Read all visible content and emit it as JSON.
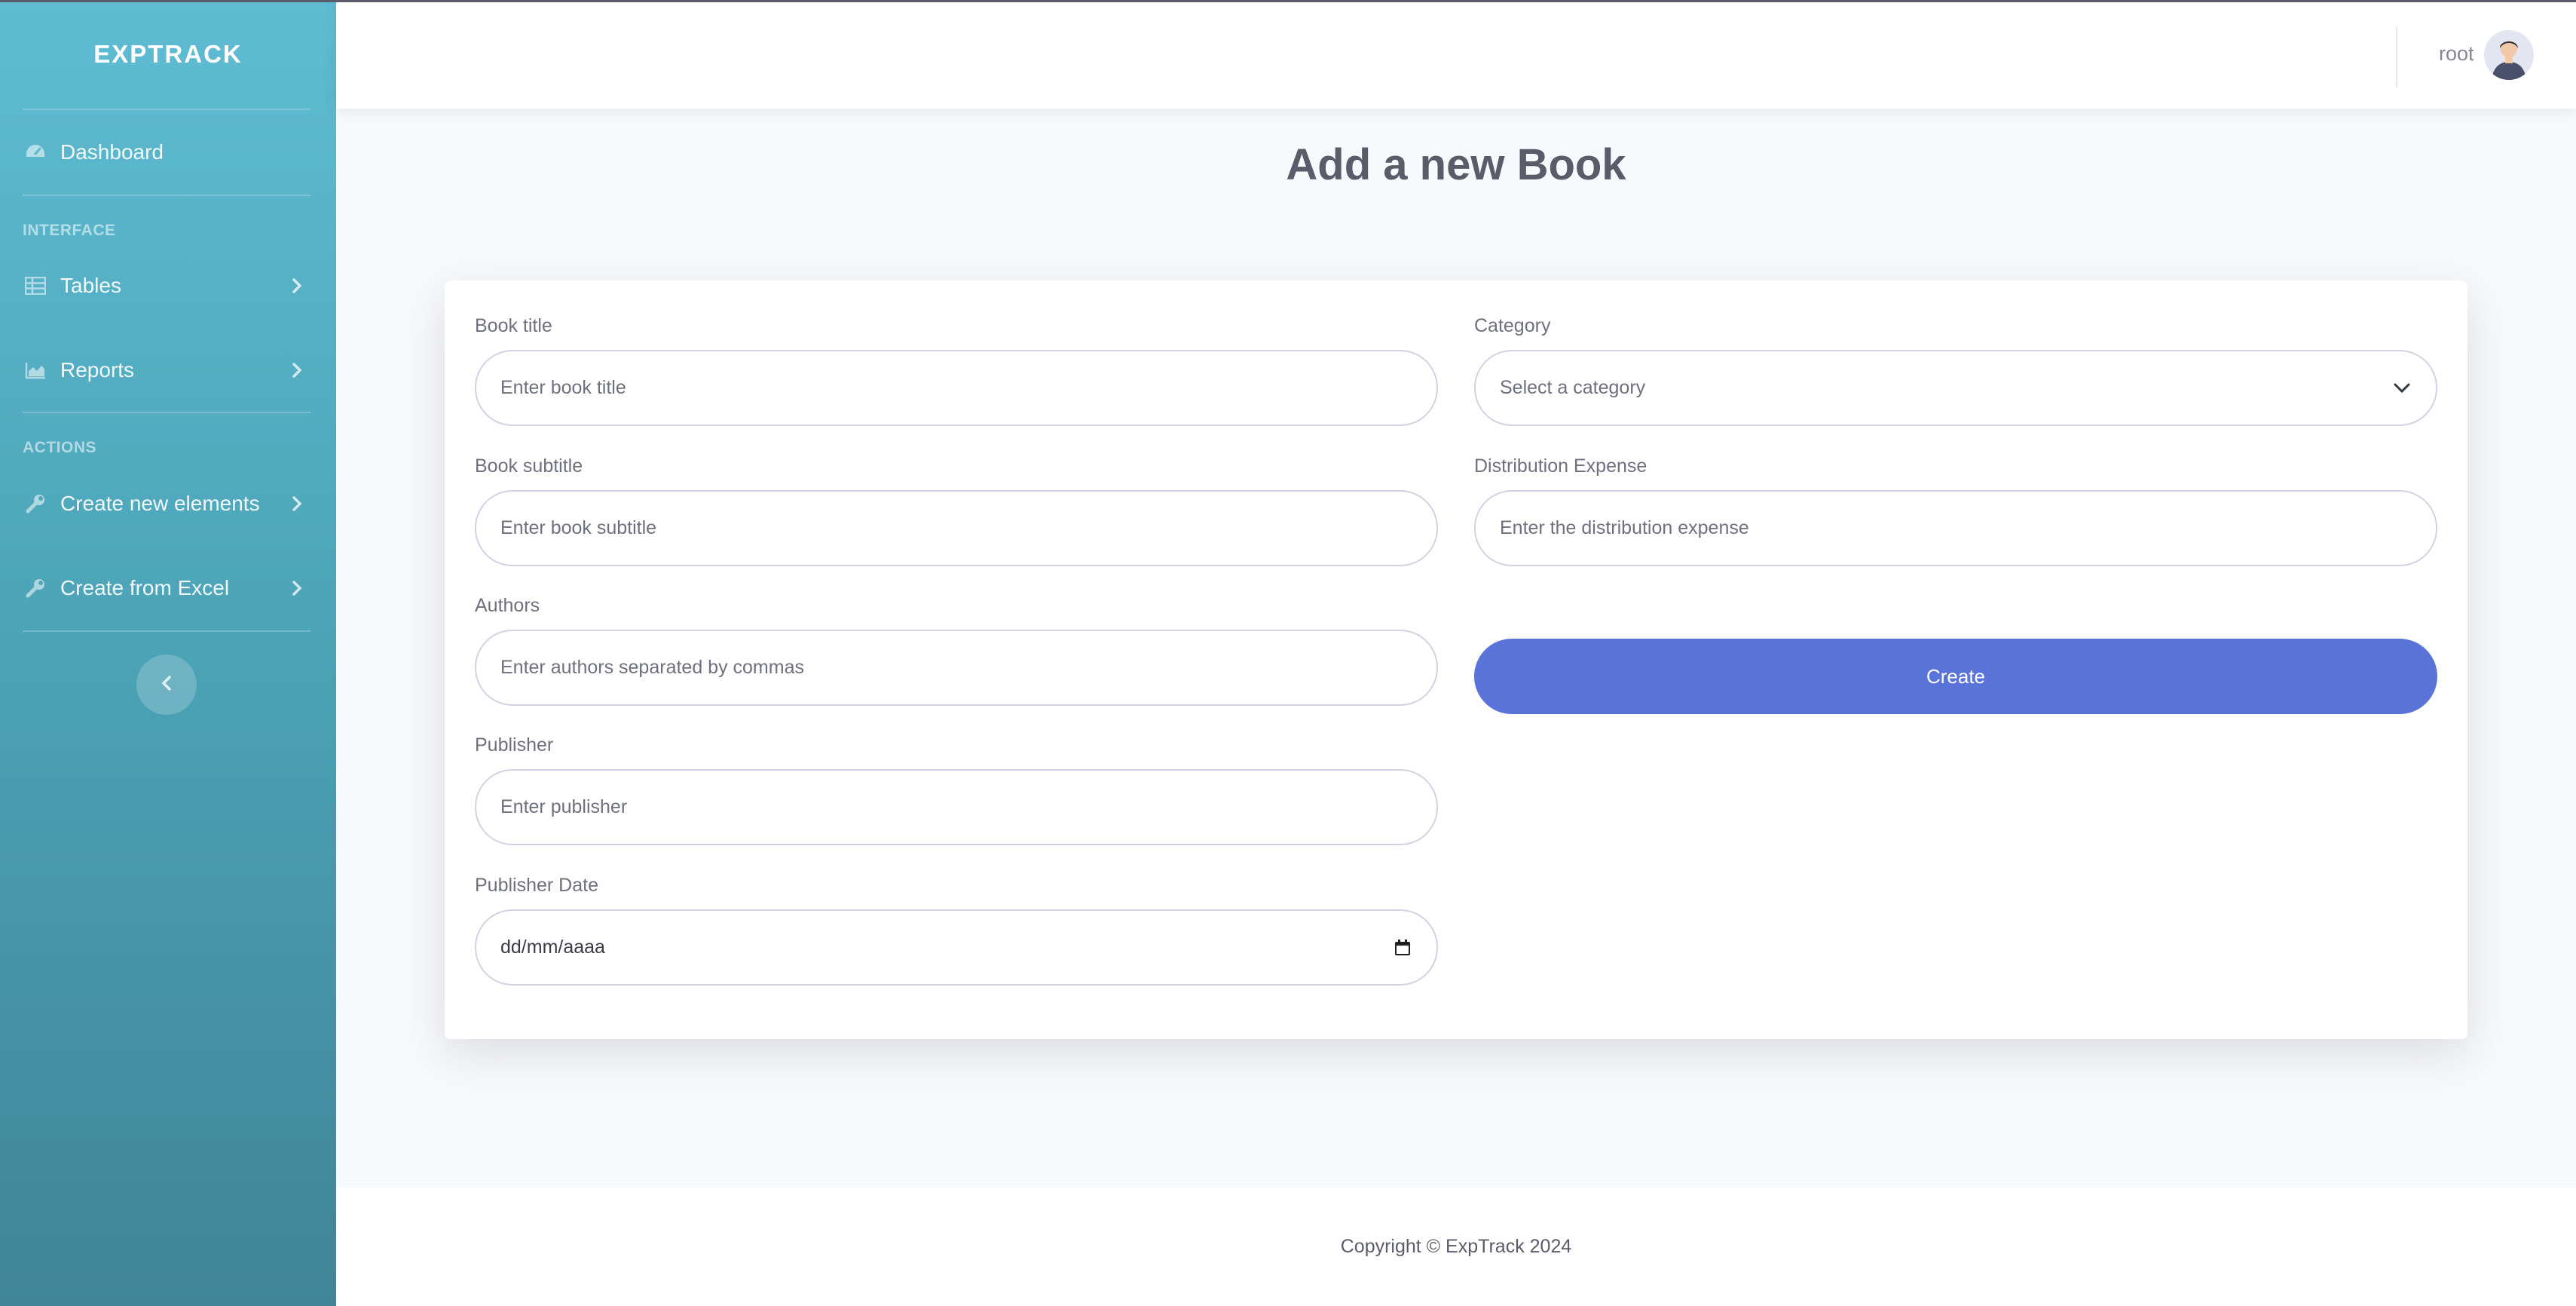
{
  "brand": "EXPTRACK",
  "sidebar": {
    "dashboard": {
      "label": "Dashboard",
      "icon": "tachometer-icon"
    },
    "interface_heading": "INTERFACE",
    "tables": {
      "label": "Tables",
      "icon": "table-icon"
    },
    "reports": {
      "label": "Reports",
      "icon": "chart-area-icon"
    },
    "actions_heading": "ACTIONS",
    "create_new": {
      "label": "Create new elements",
      "icon": "wrench-icon"
    },
    "create_excel": {
      "label": "Create from Excel",
      "icon": "wrench-icon"
    }
  },
  "topbar": {
    "username": "root"
  },
  "page": {
    "title": "Add a new Book"
  },
  "form": {
    "book_title": {
      "label": "Book title",
      "placeholder": "Enter book title",
      "value": ""
    },
    "book_subtitle": {
      "label": "Book subtitle",
      "placeholder": "Enter book subtitle",
      "value": ""
    },
    "authors": {
      "label": "Authors",
      "placeholder": "Enter authors separated by commas",
      "value": ""
    },
    "publisher": {
      "label": "Publisher",
      "placeholder": "Enter publisher",
      "value": ""
    },
    "publisher_date": {
      "label": "Publisher Date",
      "display": "dd/mm/aaaa"
    },
    "category": {
      "label": "Category",
      "selected": "Select a category"
    },
    "distribution_expense": {
      "label": "Distribution Expense",
      "placeholder": "Enter the distribution expense",
      "value": ""
    },
    "create_label": "Create"
  },
  "footer": {
    "copyright": "Copyright © ExpTrack 2024"
  },
  "colors": {
    "primary": "#5a73d9",
    "sidebar_top": "#5fbcd3",
    "sidebar_bottom": "#3f8596"
  }
}
